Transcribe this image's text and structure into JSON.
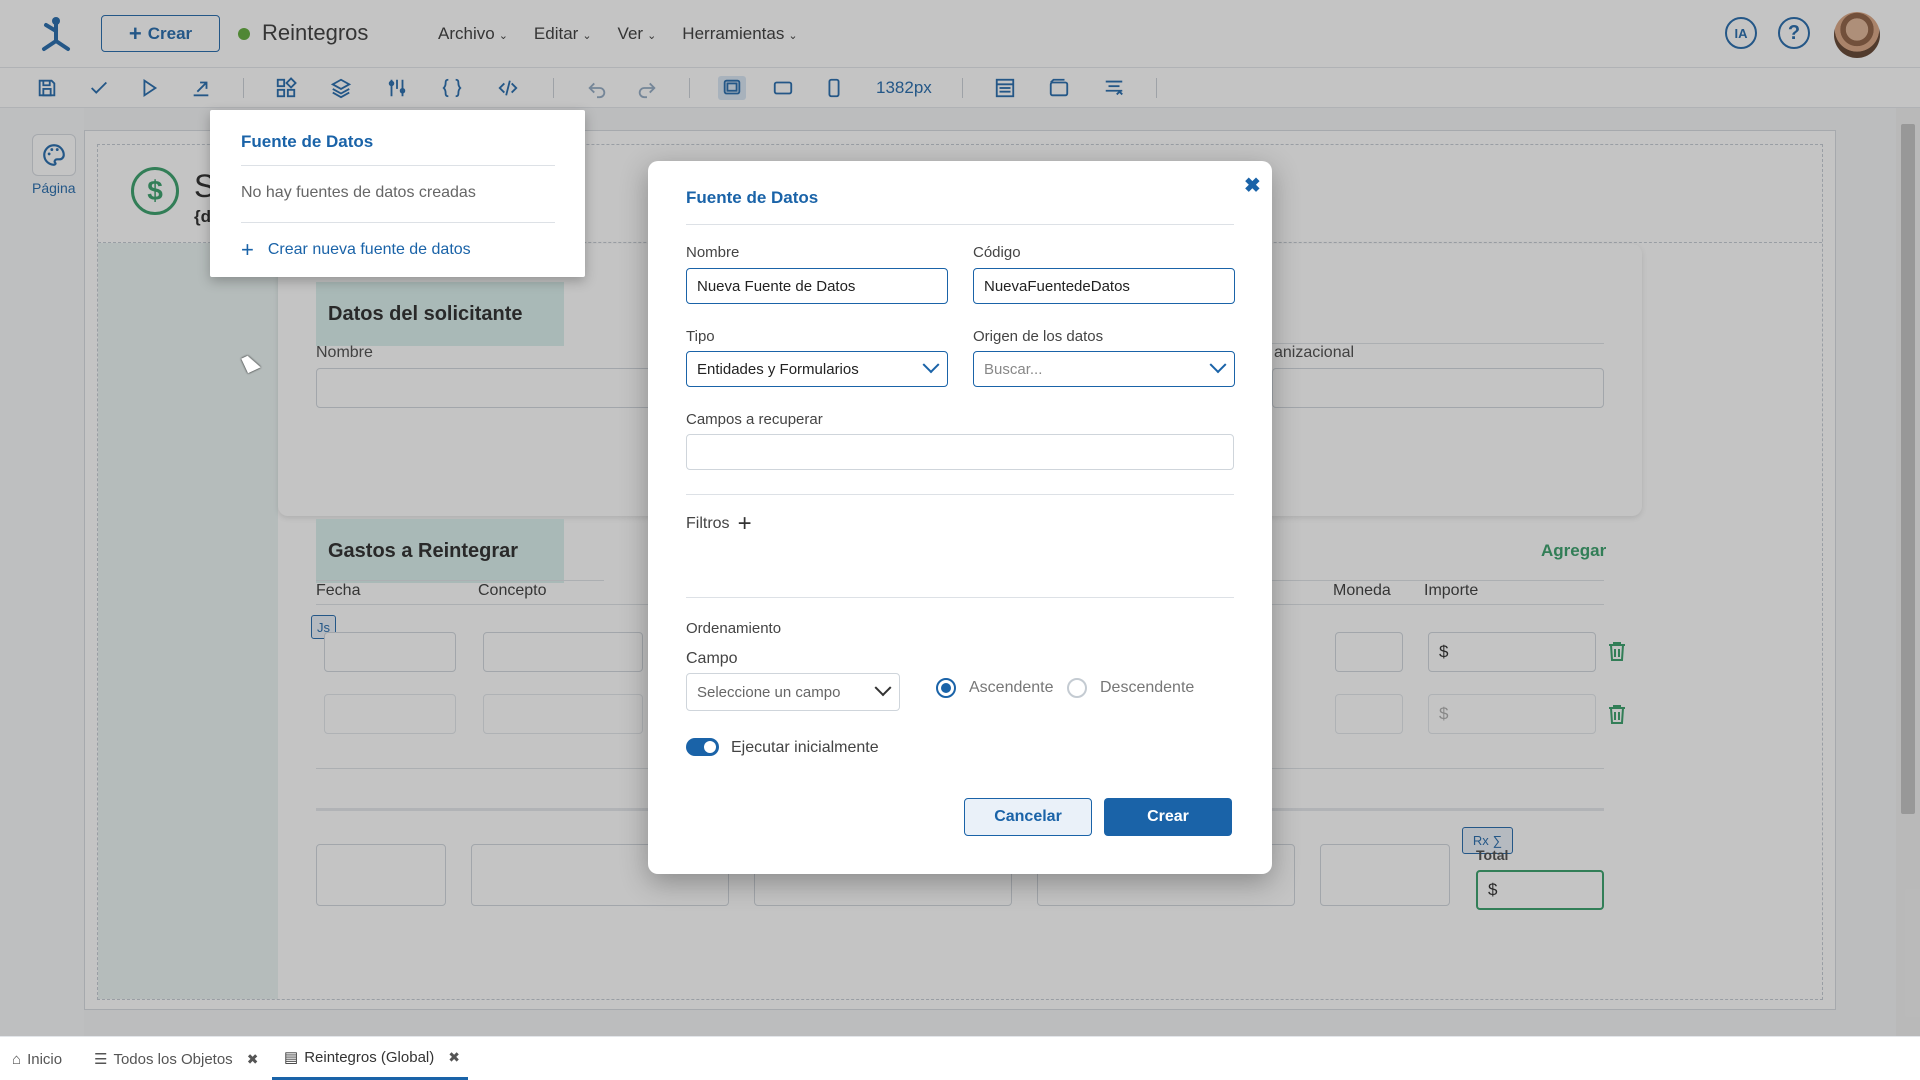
{
  "header": {
    "create_label": "Crear",
    "app_title": "Reintegros",
    "menu": [
      "Archivo",
      "Editar",
      "Ver",
      "Herramientas"
    ],
    "ia_label": "IA",
    "help_label": "?"
  },
  "toolbar": {
    "width_label": "1382px"
  },
  "left_panel": {
    "page_label": "Página"
  },
  "canvas": {
    "title_partial": "S",
    "subtitle_partial": "{d",
    "section1_title": "Datos del solicitante",
    "section1_field1": "Nombre",
    "section1_field2_partial": "anizacional",
    "section2_title": "Gastos a Reintegrar",
    "add_label": "Agregar",
    "columns": [
      "Fecha",
      "Concepto",
      "Moneda",
      "Importe"
    ],
    "currency_symbol": "$",
    "js_badge": "Js",
    "rx_badge": "Rx",
    "total_label": "Total"
  },
  "datasource_panel": {
    "title": "Fuente de Datos",
    "empty_text": "No hay fuentes de datos creadas",
    "create_link": "Crear nueva fuente de datos"
  },
  "modal": {
    "title": "Fuente de Datos",
    "name_label": "Nombre",
    "name_value": "Nueva Fuente de Datos",
    "code_label": "Código",
    "code_value": "NuevaFuentedeDatos",
    "type_label": "Tipo",
    "type_value": "Entidades y Formularios",
    "origin_label": "Origen de los datos",
    "origin_placeholder": "Buscar...",
    "fields_label": "Campos a recuperar",
    "filters_label": "Filtros",
    "ordering_label": "Ordenamiento",
    "field_label": "Campo",
    "field_placeholder": "Seleccione un campo",
    "asc_label": "Ascendente",
    "desc_label": "Descendente",
    "run_initially_label": "Ejecutar inicialmente",
    "cancel_label": "Cancelar",
    "create_label": "Crear"
  },
  "bottom_tabs": [
    {
      "label": "Inicio"
    },
    {
      "label": "Todos los Objetos"
    },
    {
      "label": "Reintegros (Global)"
    }
  ],
  "colors": {
    "accent": "#1a63a8",
    "success": "#2e9b63"
  }
}
